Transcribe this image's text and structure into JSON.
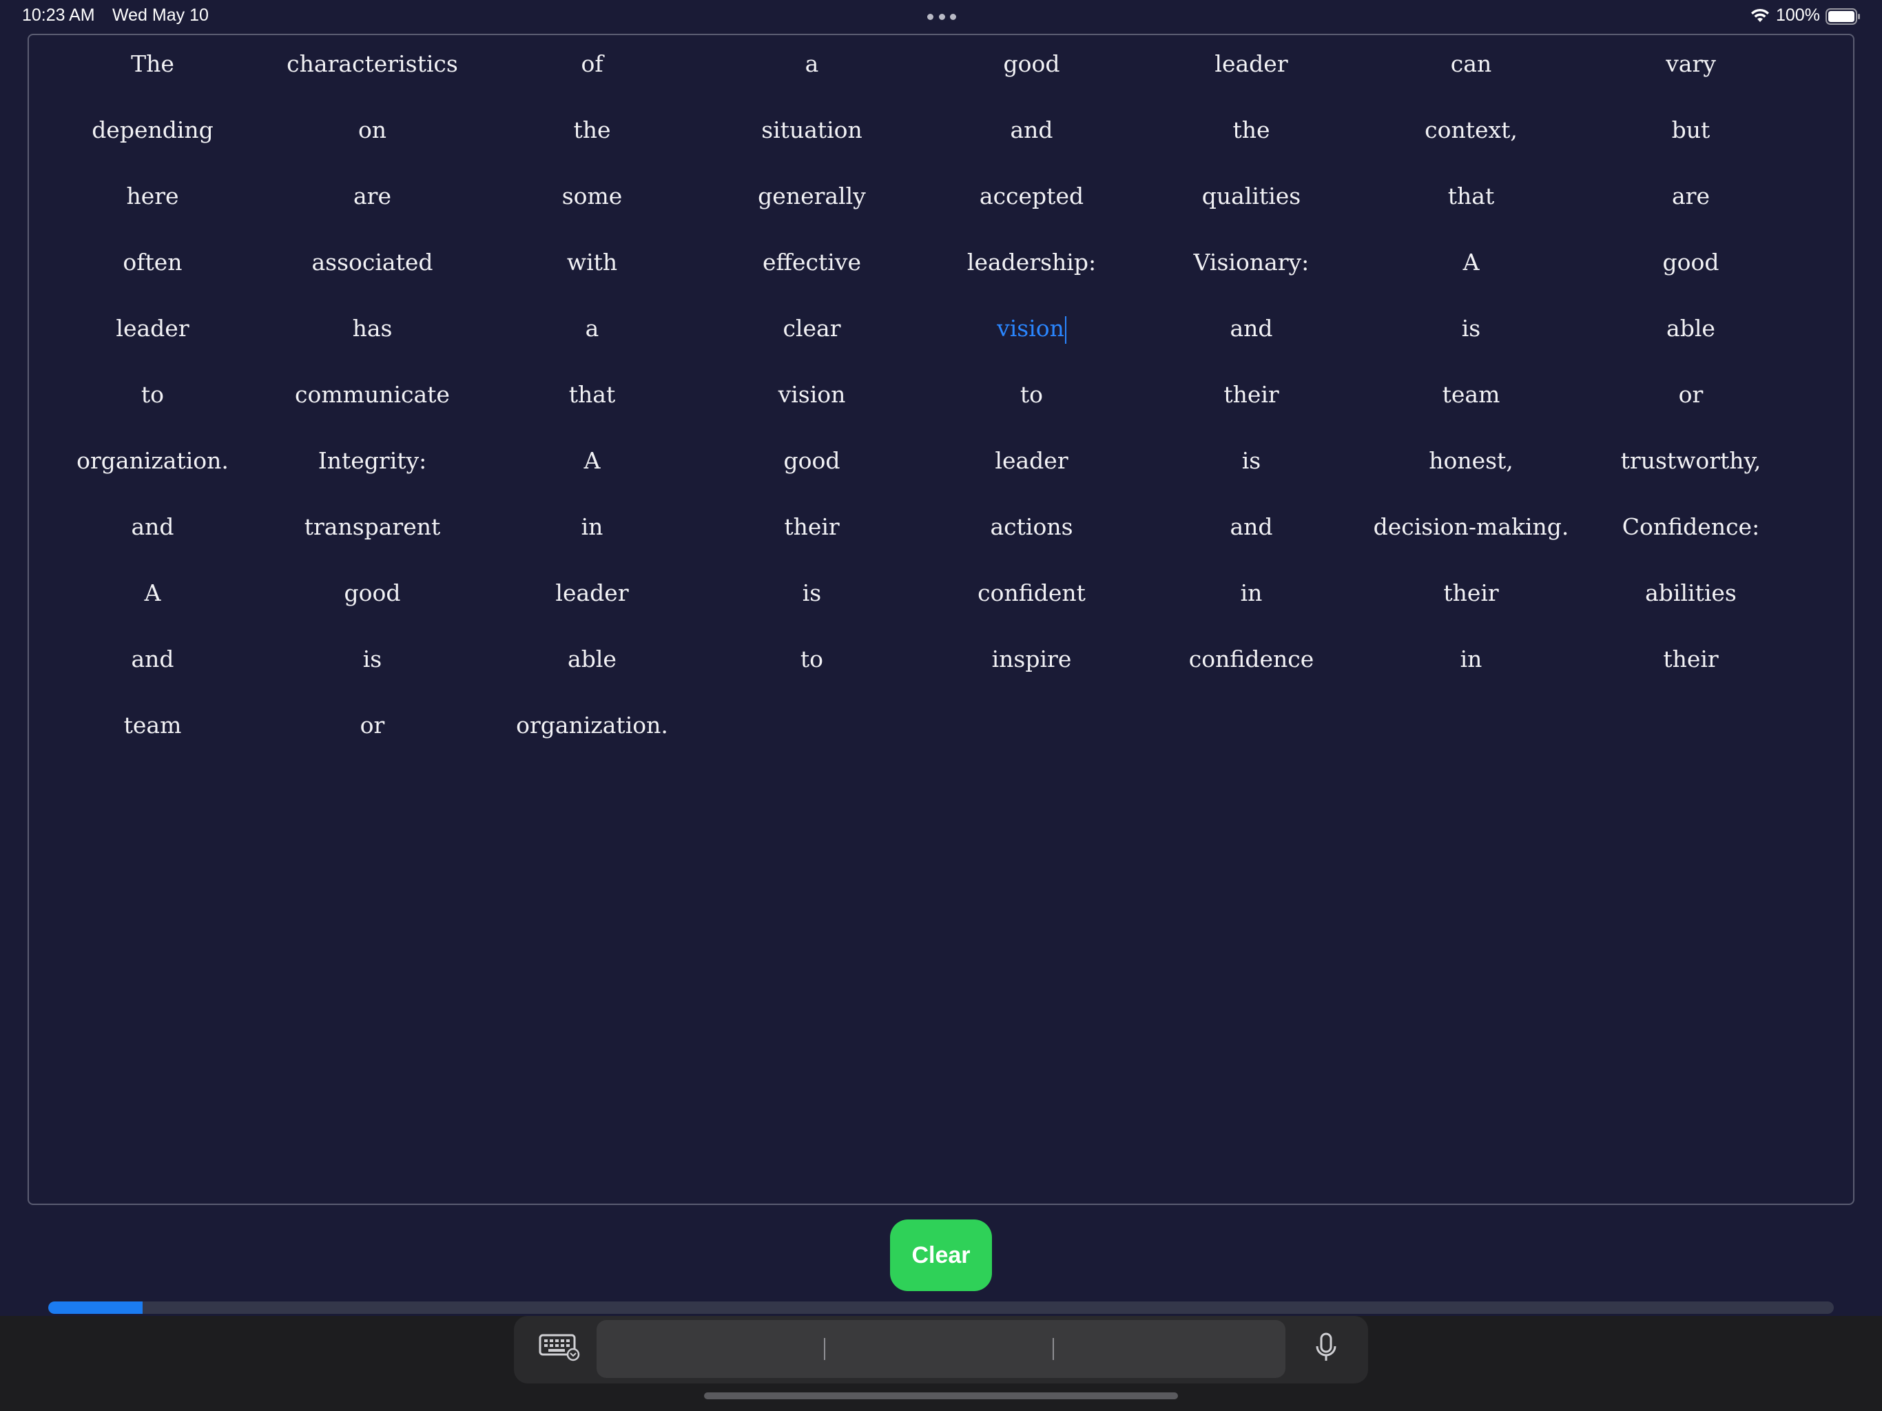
{
  "status_bar": {
    "time": "10:23 AM",
    "date": "Wed May 10",
    "battery": "100%",
    "icons": [
      "wifi-icon",
      "battery-icon",
      "multitask-dots-icon"
    ]
  },
  "document": {
    "highlighted_word_index": 36,
    "words": [
      "The",
      "characteristics",
      "of",
      "a",
      "good",
      "leader",
      "can",
      "vary",
      "depending",
      "on",
      "the",
      "situation",
      "and",
      "the",
      "context,",
      "but",
      "here",
      "are",
      "some",
      "generally",
      "accepted",
      "qualities",
      "that",
      "are",
      "often",
      "associated",
      "with",
      "effective",
      "leadership:",
      "Visionary:",
      "A",
      "good",
      "leader",
      "has",
      "a",
      "clear",
      "vision",
      "and",
      "is",
      "able",
      "to",
      "communicate",
      "that",
      "vision",
      "to",
      "their",
      "team",
      "or",
      "organization.",
      "Integrity:",
      "A",
      "good",
      "leader",
      "is",
      "honest,",
      "trustworthy,",
      "and",
      "transparent",
      "in",
      "their",
      "actions",
      "and",
      "decision-making.",
      "Confidence:",
      "A",
      "good",
      "leader",
      "is",
      "confident",
      "in",
      "their",
      "abilities",
      "and",
      "is",
      "able",
      "to",
      "inspire",
      "confidence",
      "in",
      "their",
      "team",
      "or",
      "organization."
    ]
  },
  "controls": {
    "clear_label": "Clear",
    "progress_fraction": 0.053
  },
  "colors": {
    "background": "#1a1b36",
    "highlight": "#2a86ff",
    "clear_button": "#2fd158",
    "progress": "#1b7cf2"
  }
}
